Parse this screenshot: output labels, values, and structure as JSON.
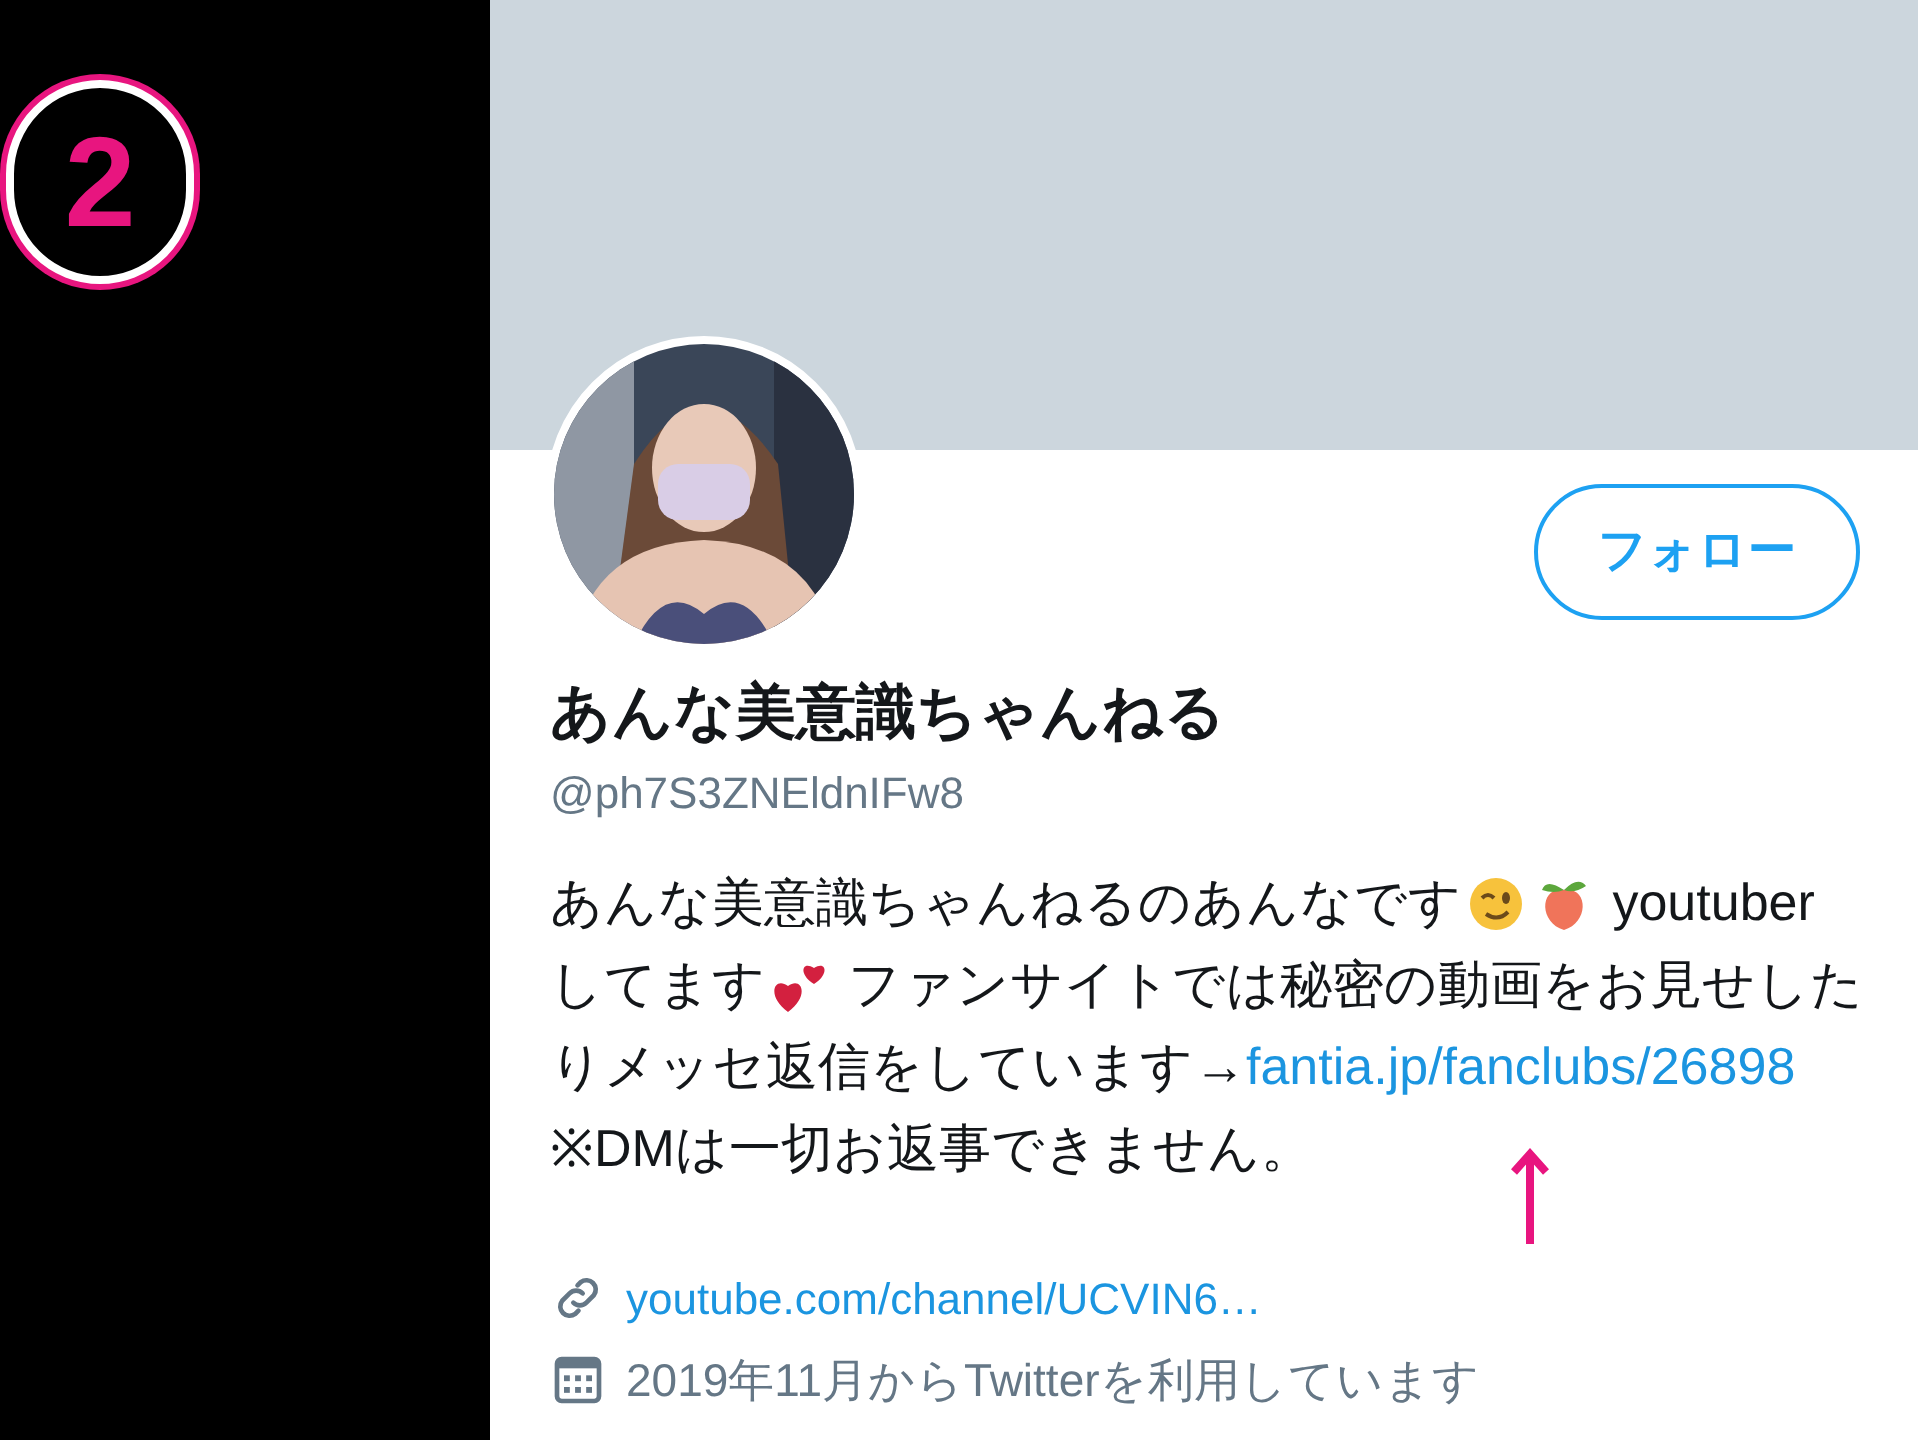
{
  "badge": {
    "label": "2"
  },
  "profile": {
    "follow_button": "フォロー",
    "name": "あんな美意識ちゃんねる",
    "handle": "@ph7S3ZNEldnIFw8",
    "bio_lines": [
      [
        {
          "kind": "text",
          "text": "あんな美意識ちゃんねるのあんなです"
        },
        {
          "kind": "wink"
        },
        {
          "kind": "peach"
        },
        {
          "kind": "text",
          "text": " youtuber"
        }
      ],
      [
        {
          "kind": "text",
          "text": "してます"
        },
        {
          "kind": "hearts"
        },
        {
          "kind": "text",
          "text": " ファンサイトでは秘密の動画をお見せした"
        }
      ],
      [
        {
          "kind": "text",
          "text": "りメッセ返信をしています→"
        },
        {
          "kind": "link",
          "text": "fantia.jp/fanclubs/26898"
        }
      ],
      [
        {
          "kind": "text",
          "text": "※DMは一切お返事できません。"
        }
      ]
    ],
    "website": "youtube.com/channel/UCVIN6…",
    "joined": "2019年11月からTwitterを利用しています"
  }
}
